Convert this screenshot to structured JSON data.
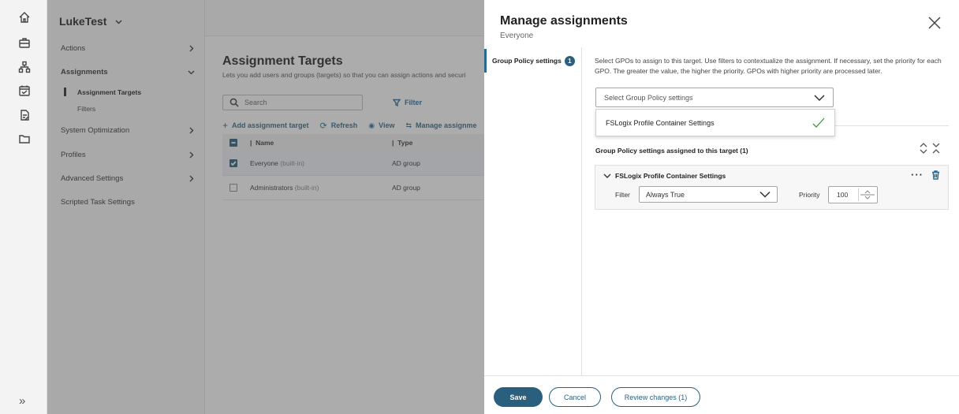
{
  "nav": {
    "tenant": "LukeTest",
    "items": [
      {
        "label": "Actions"
      },
      {
        "label": "Assignments"
      },
      {
        "label": "System Optimization"
      },
      {
        "label": "Profiles"
      },
      {
        "label": "Advanced Settings"
      },
      {
        "label": "Scripted Task Settings"
      }
    ],
    "subitems": [
      {
        "label": "Assignment Targets"
      },
      {
        "label": "Filters"
      }
    ]
  },
  "main": {
    "title": "Assignment Targets",
    "description": "Lets you add users and groups (targets) so that you can assign actions and securi",
    "search_placeholder": "Search",
    "filter_label": "Filter",
    "toolbar": {
      "add": "Add assignment target",
      "refresh": "Refresh",
      "view": "View",
      "manage": "Manage assignme"
    },
    "table": {
      "headers": [
        "Name",
        "Type"
      ],
      "rows": [
        {
          "name": "Everyone",
          "suffix": "(built-in)",
          "type": "AD group",
          "checked": true
        },
        {
          "name": "Administrators",
          "suffix": "(built-in)",
          "type": "AD group",
          "checked": false
        }
      ]
    }
  },
  "panel": {
    "title": "Manage assignments",
    "subtitle": "Everyone",
    "nav_tab": "Group Policy settings",
    "nav_badge": "1",
    "instructions": "Select GPOs to assign to this target. Use filters to contextualize the assignment. If necessary, set the priority for each GPO. The greater the value, the higher the priority. GPOs with higher priority are processed later.",
    "gpo_select_placeholder": "Select Group Policy settings",
    "dropdown_option": "FSLogix Profile Container Settings",
    "assigned_header": "Group Policy settings assigned to this target (1)",
    "assigned_card": {
      "title": "FSLogix Profile Container Settings",
      "filter_label": "Filter",
      "filter_value": "Always True",
      "priority_label": "Priority",
      "priority_value": "100"
    },
    "buttons": {
      "save": "Save",
      "cancel": "Cancel",
      "review": "Review changes (1)"
    }
  },
  "colors": {
    "accent": "#2b5f7e",
    "link": "#2c6a8f",
    "check_green": "#3c9a3c",
    "overlay": "rgba(70,70,70,0.45)"
  },
  "icons": [
    "home-icon",
    "briefcase-icon",
    "network-icon",
    "calendar-icon",
    "document-edit-icon",
    "folder-icon",
    "expand-rail-icon"
  ]
}
